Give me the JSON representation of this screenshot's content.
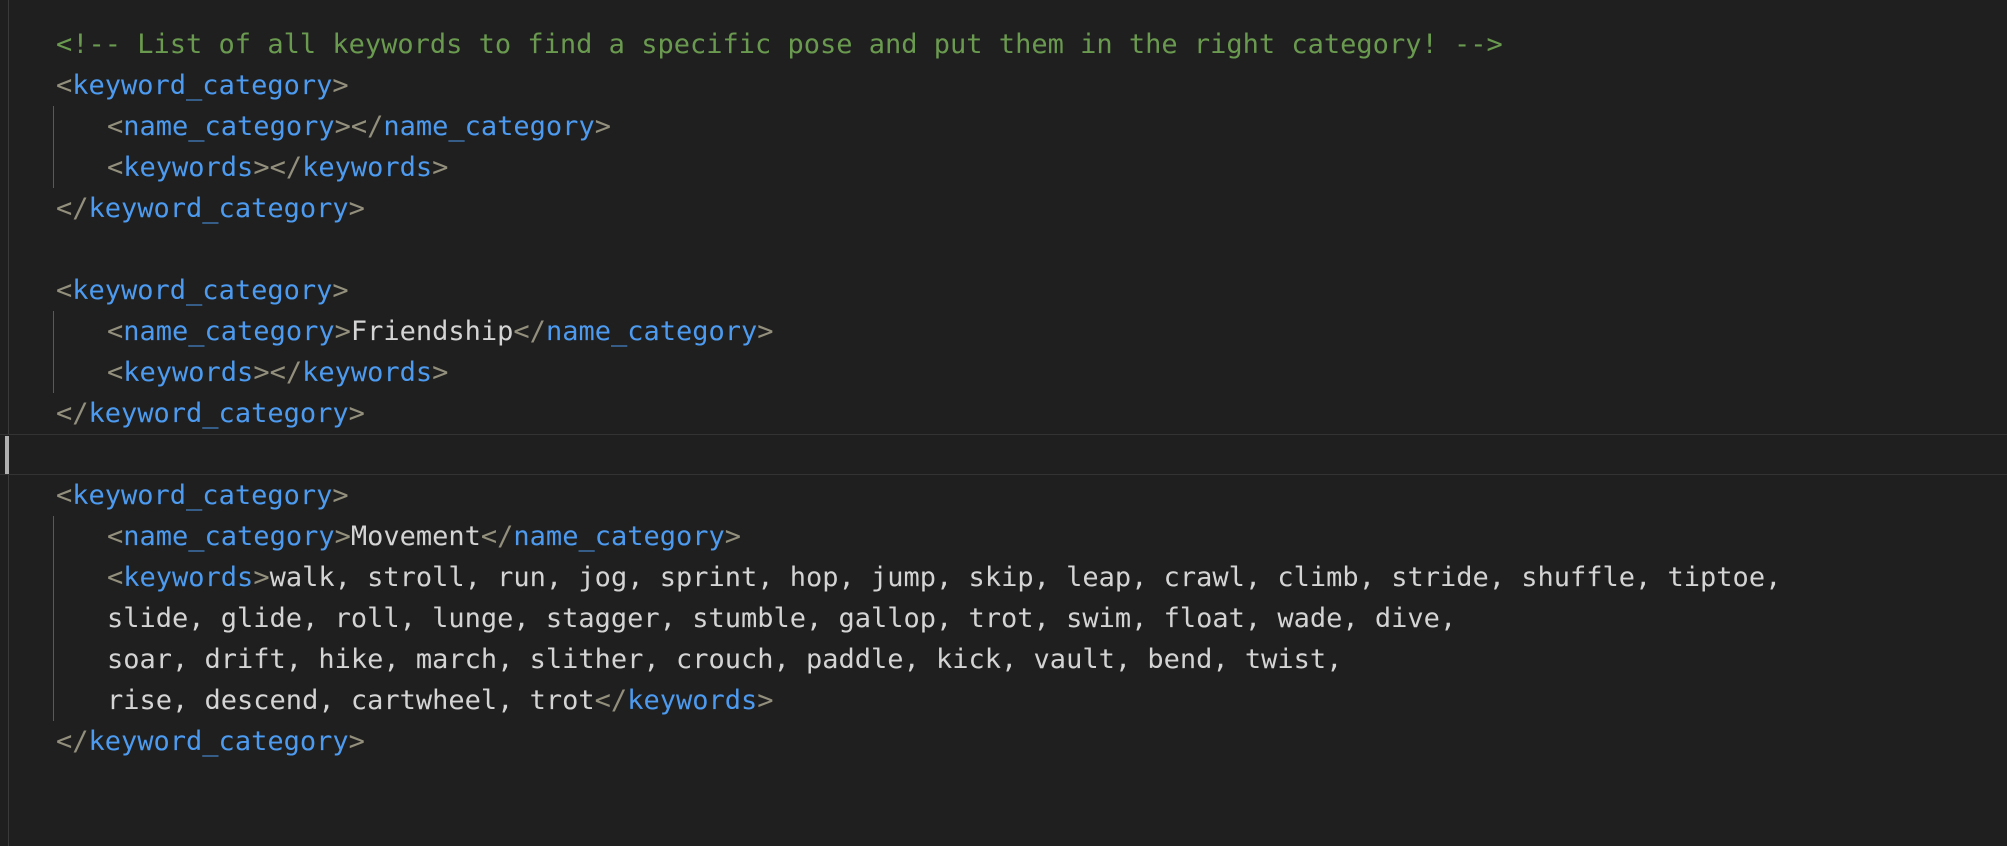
{
  "editor": {
    "language": "xml",
    "theme": "dark",
    "background_color": "#1f1f1f",
    "colors": {
      "comment": "#6a9a4f",
      "tag_name": "#4d9bf0",
      "tag_punctuation": "#938f7d",
      "text_value": "#d4d4d4",
      "indent_guide": "#5a5a52",
      "active_line_border": "#333333",
      "cursor_marker": "#b0b0b0"
    }
  },
  "comment": {
    "text": "<!-- List of all keywords to find a specific pose and put them in the right category! -->"
  },
  "tokens": {
    "open_angle": "<",
    "close_angle": ">",
    "close_angle_slash": "</",
    "keyword_category": "keyword_category",
    "name_category": "name_category",
    "keywords": "keywords"
  },
  "blocks": [
    {
      "id": "block-empty",
      "name_category": "",
      "keywords": ""
    },
    {
      "id": "block-friendship",
      "name_category": "Friendship",
      "keywords": ""
    },
    {
      "id": "block-movement",
      "name_category": "Movement",
      "keywords": "walk, stroll, run, jog, sprint, hop, jump, skip, leap, crawl, climb, stride, shuffle, tiptoe, slide, glide, roll, lunge, stagger, stumble, gallop, trot, swim, float, wade, dive, soar, drift, hike, march, slither, crouch, paddle, kick, vault, bend, twist, rise, descend, cartwheel, trot",
      "keywords_lines": [
        "walk, stroll, run, jog, sprint, hop, jump, skip, leap, crawl, climb, stride, shuffle, tiptoe,",
        "slide, glide, roll, lunge, stagger, stumble, gallop, trot, swim, float, wade, dive,",
        "soar, drift, hike, march, slither, crouch, paddle, kick, vault, bend, twist,",
        "rise, descend, cartwheel, trot"
      ]
    }
  ]
}
